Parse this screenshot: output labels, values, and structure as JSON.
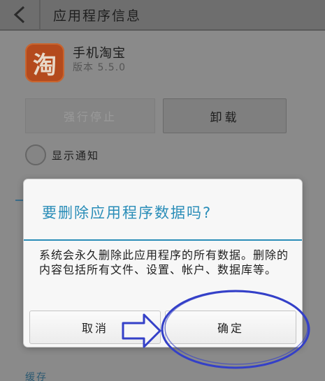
{
  "header": {
    "title": "应用程序信息"
  },
  "app": {
    "name": "手机淘宝",
    "version": "版本 5.5.0",
    "icon_glyph": "淘"
  },
  "actions": {
    "force_stop_label": "强行停止",
    "uninstall_label": "卸载"
  },
  "notify": {
    "label": "显示通知"
  },
  "section": {
    "cache_label": "缓存"
  },
  "dialog": {
    "title": "要删除应用程序数据吗?",
    "message": "系统会永久删除此应用程序的所有数据。删除的内容包括所有文件、设置、帐户、数据库等。",
    "cancel_label": "取消",
    "confirm_label": "确定"
  },
  "colors": {
    "accent": "#2a8db8",
    "annotation": "#3440c8"
  }
}
